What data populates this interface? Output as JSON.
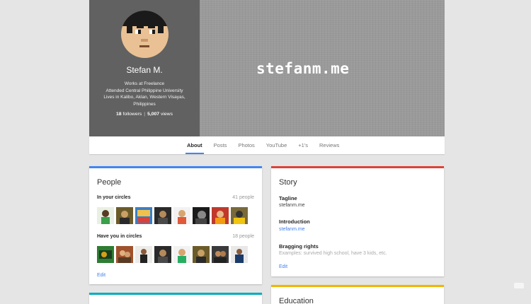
{
  "profile": {
    "name": "Stefan M.",
    "work": "Works at Freelance",
    "education": "Attended Central Philippine University",
    "location": "Lives in Kalibo, Aklan, Western Visayas, Philippines",
    "followers_count": "18",
    "followers_label": "followers",
    "views_count": "5,007",
    "views_label": "views",
    "cover_text": "stefanm.me"
  },
  "tabs": [
    {
      "label": "About",
      "active": true
    },
    {
      "label": "Posts"
    },
    {
      "label": "Photos"
    },
    {
      "label": "YouTube"
    },
    {
      "label": "+1's"
    },
    {
      "label": "Reviews"
    }
  ],
  "people": {
    "title": "People",
    "in_circles_label": "In your circles",
    "in_circles_count": "41 people",
    "have_you_label": "Have you in circles",
    "have_you_count": "18 people",
    "edit_label": "Edit"
  },
  "story": {
    "title": "Story",
    "tagline_label": "Tagline",
    "tagline_value": "stefanm.me",
    "intro_label": "Introduction",
    "intro_value": "stefanm.me",
    "bragging_label": "Bragging rights",
    "bragging_placeholder": "Examples: survived high school, have 3 kids, etc.",
    "edit_label": "Edit"
  },
  "education_card": {
    "title": "Education"
  },
  "colors": {
    "blue": "#4285f4",
    "red": "#db4437",
    "yellow": "#f4b400",
    "teal": "#00acc1",
    "link": "#427fed"
  }
}
